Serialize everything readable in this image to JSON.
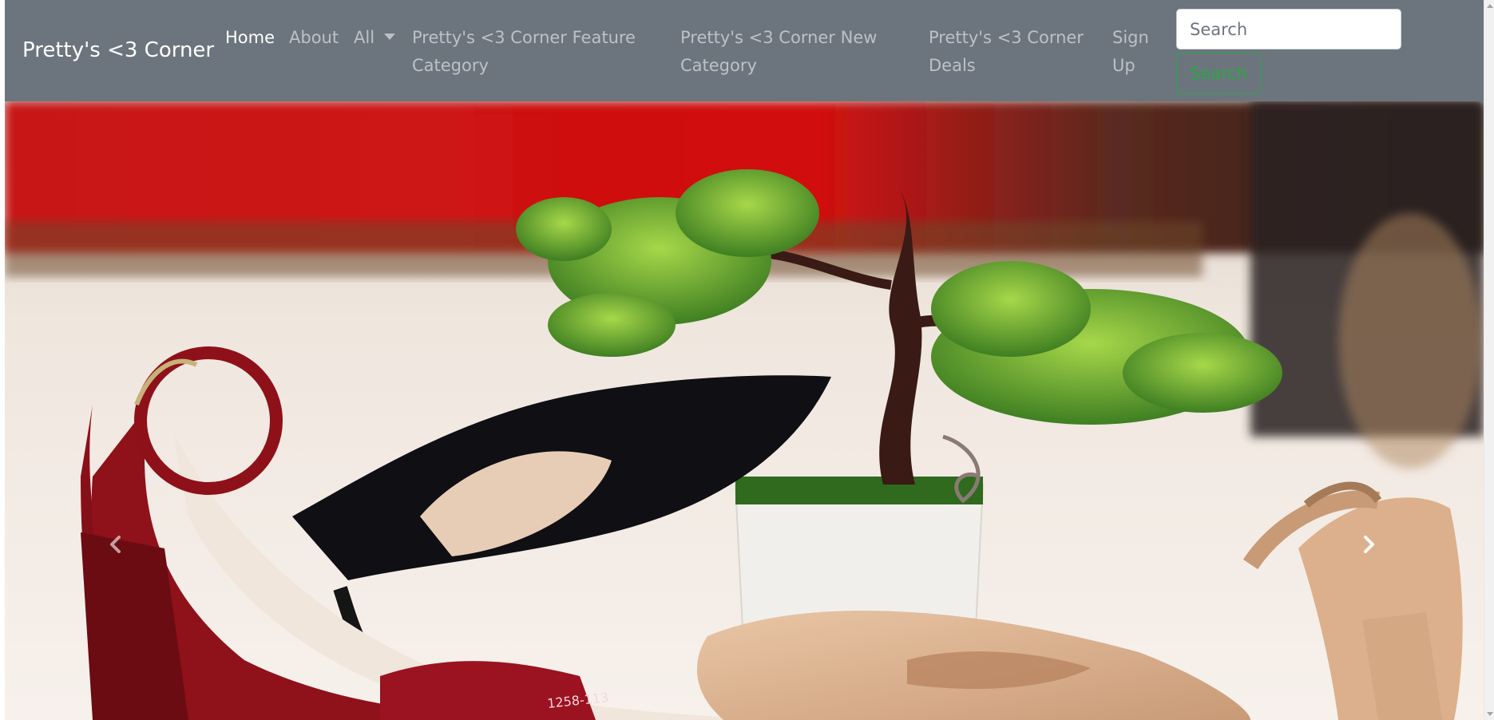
{
  "navbar": {
    "brand": "Pretty's <3 Corner",
    "links": [
      {
        "label": "Home",
        "active": true
      },
      {
        "label": "About"
      },
      {
        "label": "All"
      },
      {
        "label": "Pretty's <3 Corner Feature Category"
      },
      {
        "label": "Pretty's <3 Corner New Category"
      },
      {
        "label": "Pretty's <3 Corner Deals"
      },
      {
        "label": "Sign Up"
      }
    ],
    "search_placeholder": "Search",
    "search_button": "Search"
  },
  "colors": {
    "navbar_bg": "#6c757d",
    "search_accent": "#28a745",
    "nav_link": "rgba(255,255,255,0.55)"
  },
  "carousel": {
    "icons": {
      "prev": "chevron-left-icon",
      "next": "chevron-right-icon"
    },
    "slide_label": "1258-113"
  }
}
